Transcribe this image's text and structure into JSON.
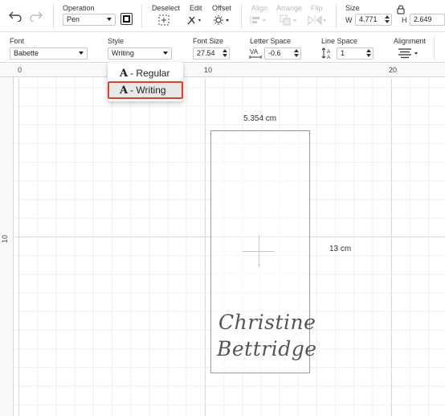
{
  "toolbar": {
    "operation_label": "Operation",
    "operation_value": "Pen",
    "deselect_label": "Deselect",
    "edit_label": "Edit",
    "offset_label": "Offset",
    "align_label": "Align",
    "arrange_label": "Arrange",
    "flip_label": "Flip",
    "size_label": "Size",
    "width_prefix": "W",
    "width_value": "4.771",
    "height_prefix": "H",
    "height_value": "2.649"
  },
  "text_toolbar": {
    "font_label": "Font",
    "font_value": "Babette",
    "style_label": "Style",
    "style_value": "Writing",
    "font_size_label": "Font Size",
    "font_size_value": "27.54",
    "letter_space_label": "Letter Space",
    "letter_space_value": "-0.6",
    "line_space_label": "Line Space",
    "line_space_value": "1",
    "alignment_label": "Alignment"
  },
  "style_dropdown": {
    "items": [
      {
        "glyph": "A",
        "label": " - Regular"
      },
      {
        "glyph": "A",
        "label": " - Writing"
      }
    ],
    "selected_index": 1,
    "highlight_color": "#d9432e"
  },
  "ruler": {
    "top_marks": [
      "0",
      "10",
      "20"
    ],
    "left_marks": [
      "10"
    ]
  },
  "canvas": {
    "width_dimension": "5.354 cm",
    "height_dimension": "13 cm",
    "text_line_1": "Christine",
    "text_line_2": "Bettridge"
  }
}
